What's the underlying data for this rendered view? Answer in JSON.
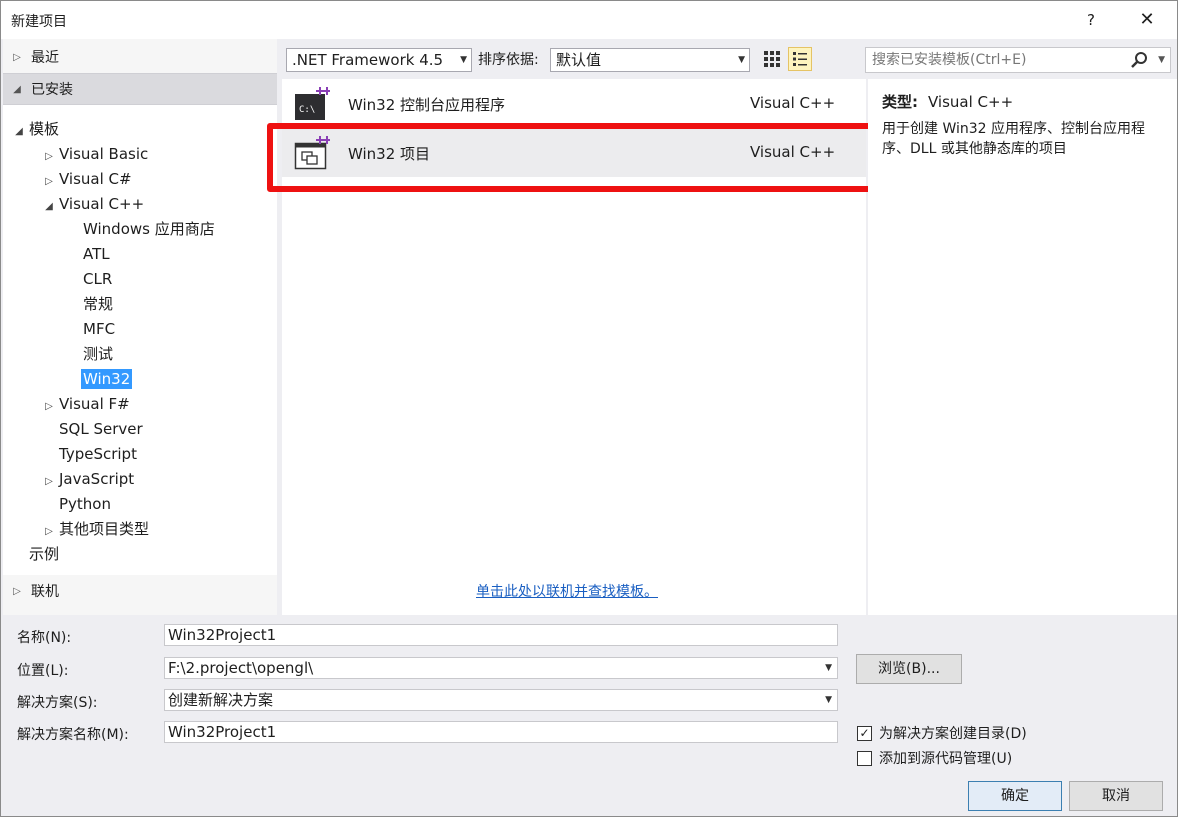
{
  "window": {
    "title": "新建项目",
    "help_label": "?",
    "close_label": "✕"
  },
  "nav": {
    "recent": "最近",
    "installed": "已安装",
    "online": "联机",
    "tree": [
      {
        "label": "模板",
        "expander": "◢",
        "level": 0
      },
      {
        "label": "Visual Basic",
        "expander": "▷",
        "level": 1
      },
      {
        "label": "Visual C#",
        "expander": "▷",
        "level": 1
      },
      {
        "label": "Visual C++",
        "expander": "◢",
        "level": 1
      },
      {
        "label": "Windows 应用商店",
        "expander": "",
        "level": 2
      },
      {
        "label": "ATL",
        "expander": "",
        "level": 2
      },
      {
        "label": "CLR",
        "expander": "",
        "level": 2
      },
      {
        "label": "常规",
        "expander": "",
        "level": 2
      },
      {
        "label": "MFC",
        "expander": "",
        "level": 2
      },
      {
        "label": "测试",
        "expander": "",
        "level": 2
      },
      {
        "label": "Win32",
        "expander": "",
        "level": 2,
        "selected": true
      },
      {
        "label": "Visual F#",
        "expander": "▷",
        "level": 1
      },
      {
        "label": "SQL Server",
        "expander": "",
        "level": 1
      },
      {
        "label": "TypeScript",
        "expander": "",
        "level": 1
      },
      {
        "label": "JavaScript",
        "expander": "▷",
        "level": 1
      },
      {
        "label": "Python",
        "expander": "",
        "level": 1
      },
      {
        "label": "其他项目类型",
        "expander": "▷",
        "level": 1
      },
      {
        "label": "示例",
        "expander": "",
        "level": 0
      }
    ]
  },
  "toolbar": {
    "framework": ".NET Framework 4.5",
    "sort_label": "排序依据:",
    "sort_value": "默认值"
  },
  "templates": [
    {
      "name": "Win32 控制台应用程序",
      "language": "Visual C++",
      "icon": "console-app-icon"
    },
    {
      "name": "Win32 项目",
      "language": "Visual C++",
      "icon": "win32-project-icon",
      "selected": true
    }
  ],
  "online_link": "单击此处以联机并查找模板。",
  "details": {
    "search_placeholder": "搜索已安装模板(Ctrl+E)",
    "type_label": "类型:",
    "type_value": "Visual C++",
    "description": "用于创建 Win32 应用程序、控制台应用程序、DLL 或其他静态库的项目"
  },
  "form": {
    "name_label": "名称(N):",
    "name_value": "Win32Project1",
    "location_label": "位置(L):",
    "location_value": "F:\\2.project\\opengl\\",
    "solution_label": "解决方案(S):",
    "solution_value": "创建新解决方案",
    "solution_name_label": "解决方案名称(M):",
    "solution_name_value": "Win32Project1",
    "browse_label": "浏览(B)...",
    "create_dir_label": "为解决方案创建目录(D)",
    "create_dir_checked": true,
    "source_control_label": "添加到源代码管理(U)",
    "source_control_checked": false,
    "ok_label": "确定",
    "cancel_label": "取消"
  },
  "colors": {
    "selection": "#3399ff",
    "highlight_box": "#ee1111",
    "link": "#1a5fc2"
  }
}
